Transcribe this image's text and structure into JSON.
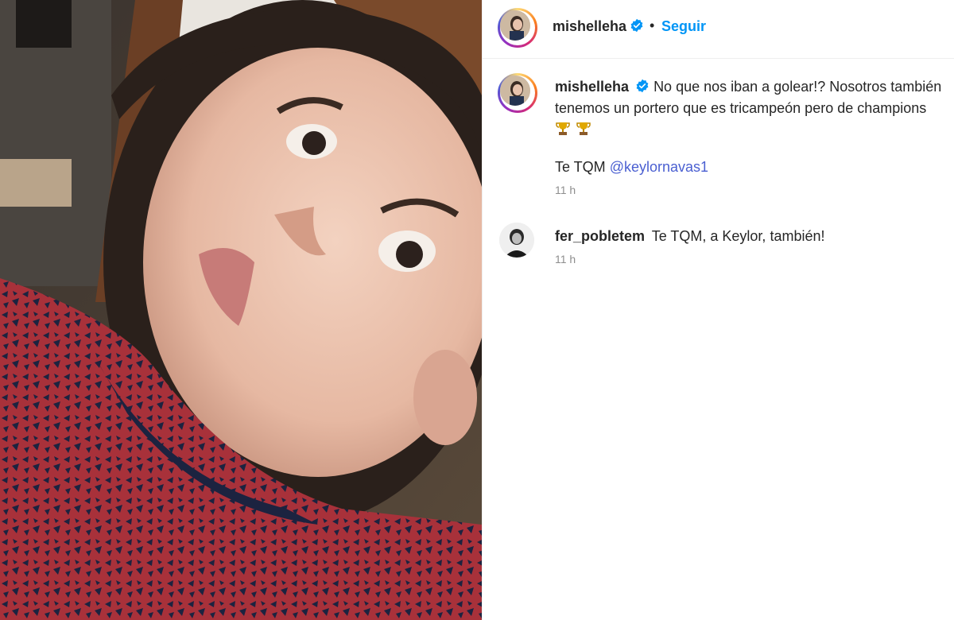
{
  "post": {
    "author": "mishelleha",
    "follow_label": "Seguir",
    "separator": "•",
    "caption_line1": "No que nos iban a golear!? Nosotros también",
    "caption_line2": "tenemos un portero que es tricampeón pero de champions",
    "caption_tqm": "Te TQM",
    "caption_mention": "@keylornavas1",
    "caption_time": "11 h"
  },
  "comments": [
    {
      "user": "fer_pobletem",
      "text": "Te TQM, a Keylor, también!",
      "time": "11 h"
    }
  ],
  "icons": {
    "verified": "verified-badge-icon",
    "trophy": "trophy-icon"
  },
  "colors": {
    "accent": "#0095f6",
    "mention": "#4a5fd1",
    "muted": "#8e8e8e",
    "text": "#262626"
  }
}
